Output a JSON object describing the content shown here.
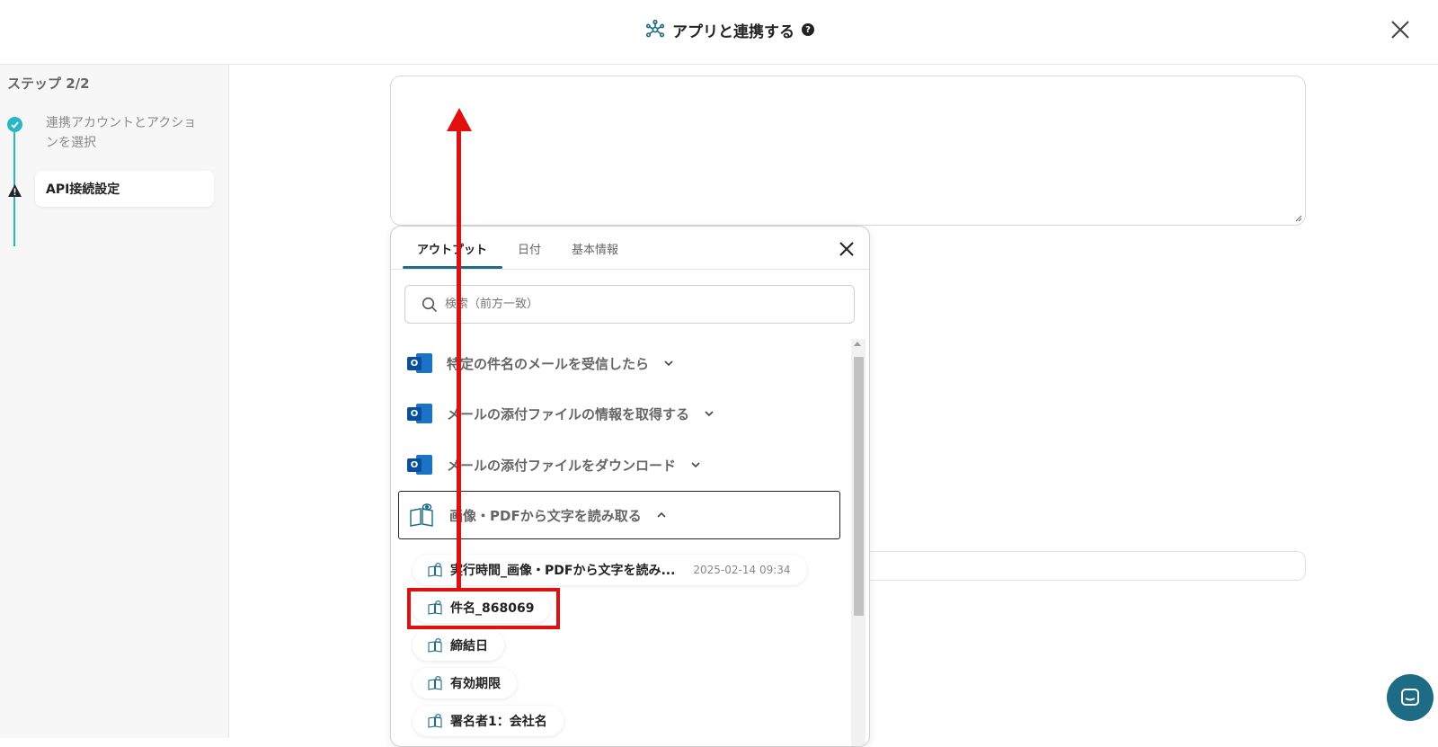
{
  "header": {
    "title": "アプリと連携する",
    "help_icon": "?"
  },
  "sidebar": {
    "step_label": "ステップ 2/2",
    "steps": [
      {
        "label": "連携アカウントとアクションを選択",
        "status": "completed"
      },
      {
        "label": "API接続設定",
        "status": "warning"
      }
    ]
  },
  "popup": {
    "tabs": [
      {
        "label": "アウトプット",
        "active": true
      },
      {
        "label": "日付",
        "active": false
      },
      {
        "label": "基本情報",
        "active": false
      }
    ],
    "search_placeholder": "検索（前方一致）",
    "actions": [
      {
        "label": "特定の件名のメールを受信したら",
        "icon": "outlook-icon",
        "expanded": false
      },
      {
        "label": "メールの添付ファイルの情報を取得する",
        "icon": "outlook-icon",
        "expanded": false
      },
      {
        "label": "メールの添付ファイルをダウンロード",
        "icon": "outlook-icon",
        "expanded": false
      },
      {
        "label": "画像・PDFから文字を読み取る",
        "icon": "ocr-book-icon",
        "expanded": true
      }
    ],
    "outputs": [
      {
        "name": "実行時間_画像・PDFから文字を読み...",
        "value": "2025-02-14 09:34"
      },
      {
        "name": "件名_868069",
        "value": ""
      },
      {
        "name": "締結日",
        "value": ""
      },
      {
        "name": "有効期限",
        "value": ""
      },
      {
        "name": "署名者1：会社名",
        "value": ""
      }
    ]
  },
  "colors": {
    "accent": "#1e6b86",
    "step_check": "#29b6c6",
    "annotation": "#e01010",
    "outlook_blue": "#0a4f9e"
  }
}
